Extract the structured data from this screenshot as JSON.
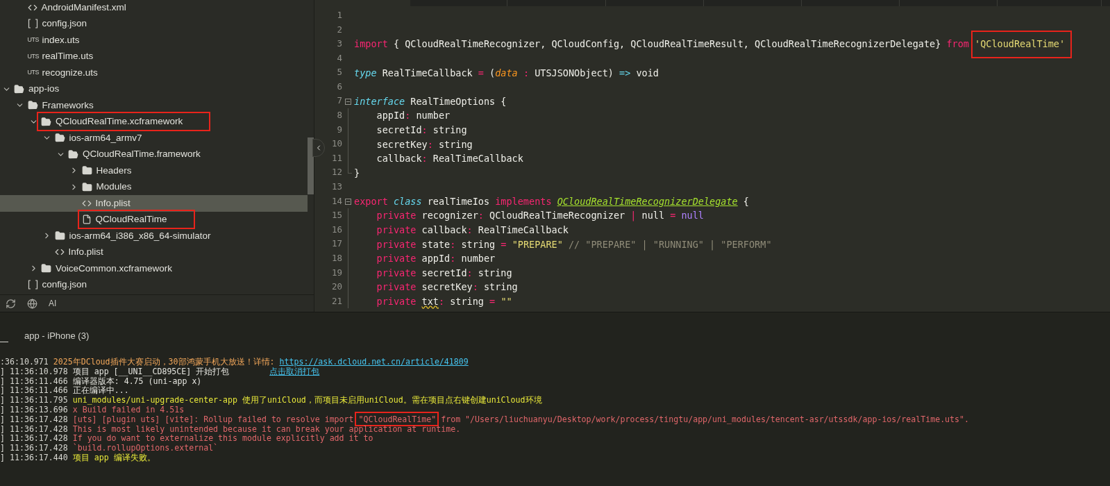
{
  "tree": {
    "continued_children": [
      {
        "name": "AndroidManifest.xml",
        "kind": "xml",
        "selected": false
      },
      {
        "name": "config.json",
        "kind": "json",
        "selected": false
      },
      {
        "name": "index.uts",
        "kind": "uts",
        "badge": "UTS",
        "selected": false
      },
      {
        "name": "realTime.uts",
        "kind": "uts",
        "badge": "UTS",
        "selected": false
      },
      {
        "name": "recognize.uts",
        "kind": "uts",
        "badge": "UTS",
        "selected": false
      }
    ],
    "items": [
      {
        "name": "app-ios",
        "kind": "folder",
        "expanded": true,
        "selected": false,
        "children": [
          {
            "name": "Frameworks",
            "kind": "folder",
            "expanded": true,
            "selected": false,
            "children": [
              {
                "name": "QCloudRealTime.xcframework",
                "kind": "folder",
                "expanded": true,
                "selected": false,
                "highlighted": true,
                "children": [
                  {
                    "name": "ios-arm64_armv7",
                    "kind": "folder",
                    "expanded": true,
                    "selected": false,
                    "children": [
                      {
                        "name": "QCloudRealTime.framework",
                        "kind": "folder",
                        "expanded": true,
                        "selected": false,
                        "children": [
                          {
                            "name": "Headers",
                            "kind": "folder",
                            "expanded": false,
                            "selected": false
                          },
                          {
                            "name": "Modules",
                            "kind": "folder",
                            "expanded": false,
                            "selected": false
                          },
                          {
                            "name": "Info.plist",
                            "kind": "xml",
                            "selected": true
                          },
                          {
                            "name": "QCloudRealTime",
                            "kind": "file",
                            "selected": false,
                            "highlighted": true
                          }
                        ]
                      }
                    ]
                  },
                  {
                    "name": "ios-arm64_i386_x86_64-simulator",
                    "kind": "folder",
                    "expanded": false,
                    "selected": false
                  },
                  {
                    "name": "Info.plist",
                    "kind": "xml",
                    "selected": false
                  }
                ]
              },
              {
                "name": "VoiceCommon.xcframework",
                "kind": "folder",
                "expanded": false,
                "selected": false
              }
            ]
          },
          {
            "name": "config.json",
            "kind": "json",
            "selected": false
          }
        ]
      }
    ],
    "toolbar": {
      "ai_label": "AI"
    }
  },
  "editor": {
    "lines": [
      {
        "number": "1"
      },
      {
        "number": "2"
      },
      {
        "number": "3",
        "tokens": [
          {
            "kind": "keyword",
            "text": "import"
          },
          {
            "kind": "plain",
            "text": " { QCloudRealTimeRecognizer, QCloudConfig, QCloudRealTimeResult, QCloudRealTimeRecognizerDelegate} "
          },
          {
            "kind": "keyword",
            "text": "from "
          },
          {
            "kind": "string",
            "text": "'QCloudRealTime'",
            "highlighted": true
          }
        ]
      },
      {
        "number": "4"
      },
      {
        "number": "5",
        "tokens": [
          {
            "kind": "storage",
            "text": "type"
          },
          {
            "kind": "plain",
            "text": " RealTimeCallback "
          },
          {
            "kind": "operator",
            "text": "="
          },
          {
            "kind": "plain",
            "text": " ("
          },
          {
            "kind": "parameter",
            "text": "data"
          },
          {
            "kind": "operator",
            "text": " :"
          },
          {
            "kind": "plain",
            "text": " UTSJSONObject) "
          },
          {
            "kind": "arrow",
            "text": "=>"
          },
          {
            "kind": "plain",
            "text": " void"
          }
        ]
      },
      {
        "number": "6"
      },
      {
        "number": "7",
        "fold_start": true,
        "tokens": [
          {
            "kind": "storage",
            "text": "interface"
          },
          {
            "kind": "plain",
            "text": " RealTimeOptions {"
          }
        ]
      },
      {
        "number": "8",
        "in_block": true,
        "tokens": [
          {
            "kind": "plain",
            "text": "    appId"
          },
          {
            "kind": "operator",
            "text": ":"
          },
          {
            "kind": "plain",
            "text": " number"
          }
        ]
      },
      {
        "number": "9",
        "in_block": true,
        "tokens": [
          {
            "kind": "plain",
            "text": "    secretId"
          },
          {
            "kind": "operator",
            "text": ":"
          },
          {
            "kind": "plain",
            "text": " string"
          }
        ]
      },
      {
        "number": "10",
        "in_block": true,
        "tokens": [
          {
            "kind": "plain",
            "text": "    secretKey"
          },
          {
            "kind": "operator",
            "text": ":"
          },
          {
            "kind": "plain",
            "text": " string"
          }
        ]
      },
      {
        "number": "11",
        "in_block": true,
        "tokens": [
          {
            "kind": "plain",
            "text": "    callback"
          },
          {
            "kind": "operator",
            "text": ":"
          },
          {
            "kind": "plain",
            "text": " RealTimeCallback"
          }
        ]
      },
      {
        "number": "12",
        "block_end": true,
        "tokens": [
          {
            "kind": "plain",
            "text": "}"
          }
        ]
      },
      {
        "number": "13"
      },
      {
        "number": "14",
        "fold_start": true,
        "tokens": [
          {
            "kind": "keyword",
            "text": "export"
          },
          {
            "kind": "storage",
            "text": " class"
          },
          {
            "kind": "plain",
            "text": " realTimeIos "
          },
          {
            "kind": "keyword",
            "text": "implements "
          },
          {
            "kind": "inherited",
            "text": "QCloudRealTimeRecognizerDelegate"
          },
          {
            "kind": "plain",
            "text": " {"
          }
        ]
      },
      {
        "number": "15",
        "in_block": true,
        "tokens": [
          {
            "kind": "keyword",
            "text": "    private"
          },
          {
            "kind": "plain",
            "text": " recognizer"
          },
          {
            "kind": "operator",
            "text": ":"
          },
          {
            "kind": "plain",
            "text": " QCloudRealTimeRecognizer "
          },
          {
            "kind": "operator",
            "text": "|"
          },
          {
            "kind": "plain",
            "text": " null "
          },
          {
            "kind": "operator",
            "text": "= "
          },
          {
            "kind": "constant",
            "text": "null"
          }
        ]
      },
      {
        "number": "16",
        "in_block": true,
        "tokens": [
          {
            "kind": "keyword",
            "text": "    private"
          },
          {
            "kind": "plain",
            "text": " callback"
          },
          {
            "kind": "operator",
            "text": ":"
          },
          {
            "kind": "plain",
            "text": " RealTimeCallback"
          }
        ]
      },
      {
        "number": "17",
        "in_block": true,
        "tokens": [
          {
            "kind": "keyword",
            "text": "    private"
          },
          {
            "kind": "plain",
            "text": " state"
          },
          {
            "kind": "operator",
            "text": ":"
          },
          {
            "kind": "plain",
            "text": " string "
          },
          {
            "kind": "operator",
            "text": "= "
          },
          {
            "kind": "string",
            "text": "\"PREPARE\""
          },
          {
            "kind": "comment",
            "text": " // \"PREPARE\" | \"RUNNING\" | \"PERFORM\""
          }
        ]
      },
      {
        "number": "18",
        "in_block": true,
        "tokens": [
          {
            "kind": "keyword",
            "text": "    private"
          },
          {
            "kind": "plain",
            "text": " appId"
          },
          {
            "kind": "operator",
            "text": ":"
          },
          {
            "kind": "plain",
            "text": " number"
          }
        ]
      },
      {
        "number": "19",
        "in_block": true,
        "tokens": [
          {
            "kind": "keyword",
            "text": "    private"
          },
          {
            "kind": "plain",
            "text": " secretId"
          },
          {
            "kind": "operator",
            "text": ":"
          },
          {
            "kind": "plain",
            "text": " string"
          }
        ]
      },
      {
        "number": "20",
        "in_block": true,
        "tokens": [
          {
            "kind": "keyword",
            "text": "    private"
          },
          {
            "kind": "plain",
            "text": " secretKey"
          },
          {
            "kind": "operator",
            "text": ":"
          },
          {
            "kind": "plain",
            "text": " string"
          }
        ]
      },
      {
        "number": "21",
        "in_block": true,
        "tokens": [
          {
            "kind": "keyword",
            "text": "    private "
          },
          {
            "kind": "warning",
            "text": "txt"
          },
          {
            "kind": "operator",
            "text": ":"
          },
          {
            "kind": "plain",
            "text": " string "
          },
          {
            "kind": "operator",
            "text": "= "
          },
          {
            "kind": "string",
            "text": "\"\""
          }
        ]
      }
    ]
  },
  "console": {
    "title": "app - iPhone (3)",
    "lines": [
      {
        "segments": [
          {
            "kind": "time",
            "text": ":36:10.971 "
          },
          {
            "kind": "notice",
            "text": "2025年DCloud插件大赛启动，30部鸿蒙手机大放送！详情: "
          },
          {
            "kind": "link",
            "text": "https://ask.dcloud.net.cn/article/41809"
          }
        ]
      },
      {
        "segments": [
          {
            "kind": "time",
            "text": "] 11:36:10.978 "
          },
          {
            "kind": "info",
            "text": "项目 app [__UNI__CD895CE] 开始打包"
          },
          {
            "kind": "action",
            "text": "点击取消打包"
          }
        ]
      },
      {
        "segments": [
          {
            "kind": "time",
            "text": "] 11:36:11.466 "
          },
          {
            "kind": "info",
            "text": "编译器版本: 4.75 (uni-app x)"
          }
        ]
      },
      {
        "segments": [
          {
            "kind": "time",
            "text": "] 11:36:11.466 "
          },
          {
            "kind": "info",
            "text": "正在编译中..."
          }
        ]
      },
      {
        "segments": [
          {
            "kind": "time",
            "text": "] 11:36:11.795 "
          },
          {
            "kind": "warn",
            "text": "uni_modules/uni-upgrade-center-app 使用了uniCloud，而项目未启用uniCloud。需在项目点右键创建uniCloud环境"
          }
        ]
      },
      {
        "segments": [
          {
            "kind": "time",
            "text": "] 11:36:13.696 "
          },
          {
            "kind": "error",
            "text": "x Build failed in 4.51s"
          }
        ]
      },
      {
        "segments": [
          {
            "kind": "time",
            "text": "] 11:36:17.428 "
          },
          {
            "kind": "error",
            "text": "[uts] [plugin uts] [vite]: Rollup failed to resolve import "
          },
          {
            "kind": "error",
            "text": "\"QCloudRealTime\"",
            "highlighted": true
          },
          {
            "kind": "error",
            "text": " from \"/Users/liuchuanyu/Desktop/work/process/tingtu/app/uni_modules/tencent-asr/utssdk/app-ios/realTime.uts\"."
          }
        ]
      },
      {
        "segments": [
          {
            "kind": "time",
            "text": "] 11:36:17.428 "
          },
          {
            "kind": "error",
            "text": "This is most likely unintended because it can break your application at runtime."
          }
        ]
      },
      {
        "segments": [
          {
            "kind": "time",
            "text": "] 11:36:17.428 "
          },
          {
            "kind": "error",
            "text": "If you do want to externalize this module explicitly add it to"
          }
        ]
      },
      {
        "segments": [
          {
            "kind": "time",
            "text": "] 11:36:17.428 "
          },
          {
            "kind": "error",
            "text": "`build.rollupOptions.external`"
          }
        ]
      },
      {
        "segments": [
          {
            "kind": "time",
            "text": "] 11:36:17.440 "
          },
          {
            "kind": "warn",
            "text": "项目 app 编译失败。"
          }
        ]
      }
    ]
  }
}
